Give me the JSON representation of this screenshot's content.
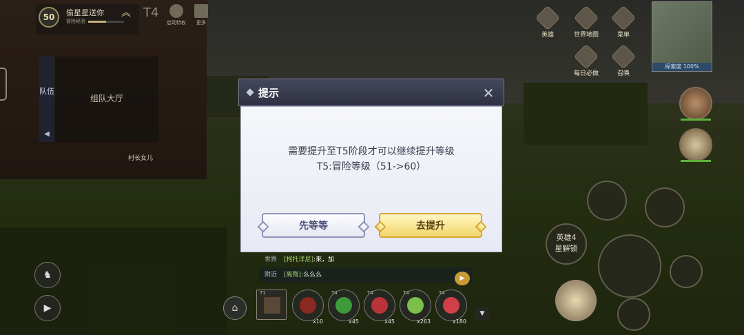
{
  "player": {
    "level": "50",
    "name": "偷星星送你",
    "subtitle": "冒险经验",
    "exp_fraction": 0.5,
    "rank": "T4",
    "top_icons": [
      "启动特权",
      "更多"
    ]
  },
  "team": {
    "tab_label": "队伍",
    "hall_label": "组队大厅"
  },
  "npc_label": "村长女儿",
  "right_menu": {
    "icons": [
      "英雄",
      "世界地图",
      "菜单",
      "每日必做",
      "召唤"
    ],
    "explore_label": "探索度 100%"
  },
  "skills": {
    "unlock_text": [
      "英雄4",
      "星解锁"
    ]
  },
  "chat": {
    "rows": [
      {
        "channel": "世界",
        "name": "[柯托洋尼]",
        "text": ":來，加"
      },
      {
        "channel": "附近",
        "name": "[离殇]",
        "text": ":么么么"
      }
    ]
  },
  "items": [
    {
      "count": "",
      "lvl": "T1"
    },
    {
      "count": "x10",
      "lvl": ""
    },
    {
      "count": "x45",
      "lvl": "T4"
    },
    {
      "count": "x45",
      "lvl": "T4"
    },
    {
      "count": "x263",
      "lvl": "T4"
    },
    {
      "count": "x180",
      "lvl": "T4"
    }
  ],
  "dialog": {
    "title": "提示",
    "message_line1": "需要提升至T5阶段才可以继续提升等级",
    "message_line2": "T5:冒险等级（51->60）",
    "cancel_label": "先等等",
    "confirm_label": "去提升"
  },
  "colors": {
    "confirm_fill": "#f3d76a",
    "cancel_border": "#8e93b8",
    "dialog_header": "#2e3042"
  }
}
